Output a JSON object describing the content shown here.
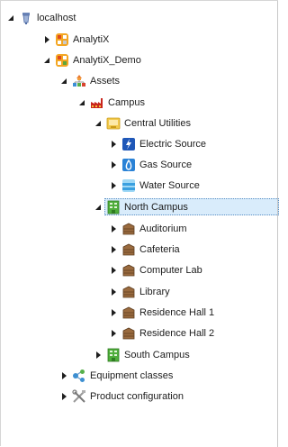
{
  "tree": {
    "root": {
      "label": "localhost",
      "icon": "server-icon",
      "expanded": true
    },
    "analytix": {
      "label": "AnalytiX",
      "icon": "analytix-icon",
      "expanded": false
    },
    "analytix_demo": {
      "label": "AnalytiX_Demo",
      "icon": "analytix-icon",
      "expanded": true
    },
    "assets": {
      "label": "Assets",
      "icon": "assets-hierarchy-icon",
      "expanded": true
    },
    "campus": {
      "label": "Campus",
      "icon": "factory-icon",
      "expanded": true
    },
    "central_utilities": {
      "label": "Central Utilities",
      "icon": "utility-box-icon",
      "expanded": true
    },
    "electric_source": {
      "label": "Electric Source",
      "icon": "lightning-icon",
      "expanded": false
    },
    "gas_source": {
      "label": "Gas Source",
      "icon": "flame-icon",
      "expanded": false
    },
    "water_source": {
      "label": "Water Source",
      "icon": "water-icon",
      "expanded": false
    },
    "north_campus": {
      "label": "North Campus",
      "icon": "building-icon",
      "expanded": true,
      "selected": true
    },
    "auditorium": {
      "label": "Auditorium",
      "icon": "building-block-icon",
      "expanded": false
    },
    "cafeteria": {
      "label": "Cafeteria",
      "icon": "building-block-icon",
      "expanded": false
    },
    "computer_lab": {
      "label": "Computer Lab",
      "icon": "building-block-icon",
      "expanded": false
    },
    "library": {
      "label": "Library",
      "icon": "building-block-icon",
      "expanded": false
    },
    "residence_hall_1": {
      "label": "Residence Hall 1",
      "icon": "building-block-icon",
      "expanded": false
    },
    "residence_hall_2": {
      "label": "Residence Hall 2",
      "icon": "building-block-icon",
      "expanded": false
    },
    "south_campus": {
      "label": "South Campus",
      "icon": "building-icon",
      "expanded": false
    },
    "equipment_classes": {
      "label": "Equipment classes",
      "icon": "equipment-classes-icon",
      "expanded": false
    },
    "product_configuration": {
      "label": "Product configuration",
      "icon": "tools-icon",
      "expanded": false
    }
  },
  "colors": {
    "selection_bg": "#d9ecfb",
    "selection_border": "#5a8fc4",
    "expander": "#1e1e1e",
    "text": "#1c1c1c"
  }
}
